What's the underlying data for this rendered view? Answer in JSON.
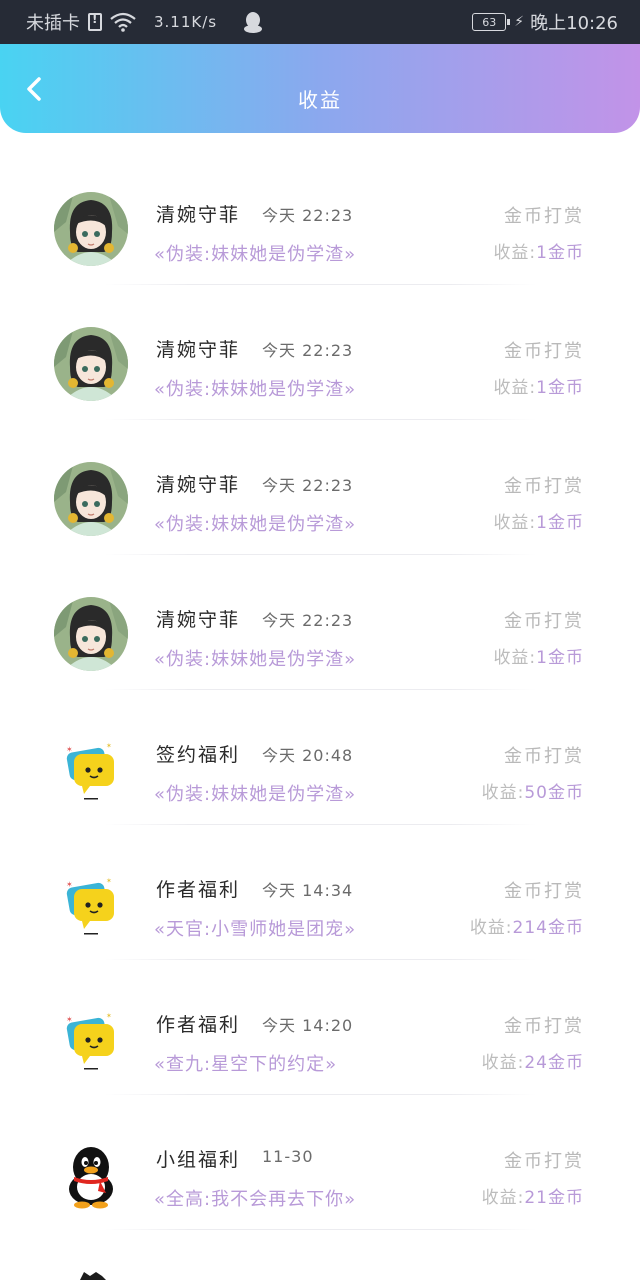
{
  "status_bar": {
    "carrier": "未插卡",
    "speed": "3.11K/s",
    "battery": "63",
    "time": "晚上10:26"
  },
  "header": {
    "title": "收益",
    "back_icon": "chevron-left-icon"
  },
  "income_label": "收益:",
  "items": [
    {
      "avatar": "anime-girl",
      "name": "清婉守菲",
      "time": "今天 22:23",
      "book": "«伪装:妹妹她是伪学渣»",
      "type": "金币打赏",
      "income": "1金币"
    },
    {
      "avatar": "anime-girl",
      "name": "清婉守菲",
      "time": "今天 22:23",
      "book": "«伪装:妹妹她是伪学渣»",
      "type": "金币打赏",
      "income": "1金币"
    },
    {
      "avatar": "anime-girl",
      "name": "清婉守菲",
      "time": "今天 22:23",
      "book": "«伪装:妹妹她是伪学渣»",
      "type": "金币打赏",
      "income": "1金币"
    },
    {
      "avatar": "anime-girl",
      "name": "清婉守菲",
      "time": "今天 22:23",
      "book": "«伪装:妹妹她是伪学渣»",
      "type": "金币打赏",
      "income": "1金币"
    },
    {
      "avatar": "chat-bubble",
      "name": "签约福利",
      "time": "今天 20:48",
      "book": "«伪装:妹妹她是伪学渣»",
      "type": "金币打赏",
      "income": "50金币"
    },
    {
      "avatar": "chat-bubble",
      "name": "作者福利",
      "time": "今天 14:34",
      "book": "«天官:小雪师她是团宠»",
      "type": "金币打赏",
      "income": "214金币"
    },
    {
      "avatar": "chat-bubble",
      "name": "作者福利",
      "time": "今天 14:20",
      "book": "«查九:星空下的约定»",
      "type": "金币打赏",
      "income": "24金币"
    },
    {
      "avatar": "penguin",
      "name": "小组福利",
      "time": "11-30",
      "book": "«全高:我不会再去下你»",
      "type": "金币打赏",
      "income": "21金币"
    }
  ]
}
